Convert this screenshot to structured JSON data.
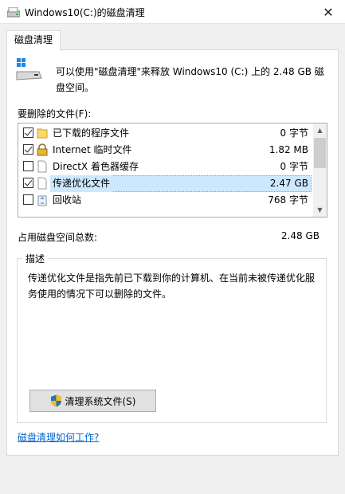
{
  "window": {
    "title": "Windows10(C:)的磁盘清理",
    "close_glyph": "✕"
  },
  "tabs": [
    {
      "label": "磁盘清理",
      "active": true
    }
  ],
  "intro": {
    "text": "可以使用\"磁盘清理\"来释放 Windows10 (C:) 上的 2.48 GB 磁盘空间。"
  },
  "files": {
    "label": "要删除的文件(F):",
    "items": [
      {
        "name": "已下载的程序文件",
        "size": "0 字节",
        "checked": true,
        "icon": "folder-icon",
        "selected": false
      },
      {
        "name": "Internet 临时文件",
        "size": "1.82 MB",
        "checked": true,
        "icon": "lock-icon",
        "selected": false
      },
      {
        "name": "DirectX 着色器缓存",
        "size": "0 字节",
        "checked": false,
        "icon": "file-icon",
        "selected": false
      },
      {
        "name": "传递优化文件",
        "size": "2.47 GB",
        "checked": true,
        "icon": "file-icon",
        "selected": true
      },
      {
        "name": "回收站",
        "size": "768 字节",
        "checked": false,
        "icon": "recycle-bin-icon",
        "selected": false
      }
    ],
    "scroll_up": "▲",
    "scroll_down": "▼"
  },
  "total": {
    "label": "占用磁盘空间总数:",
    "value": "2.48 GB"
  },
  "description": {
    "title": "描述",
    "text": "传递优化文件是指先前已下载到你的计算机、在当前未被传递优化服务使用的情况下可以删除的文件。"
  },
  "buttons": {
    "cleanup_system": "清理系统文件(S)"
  },
  "help": {
    "link": "磁盘清理如何工作?"
  },
  "colors": {
    "selection": "#cce8ff",
    "link": "#0066cc",
    "background": "#f0f0f0"
  }
}
